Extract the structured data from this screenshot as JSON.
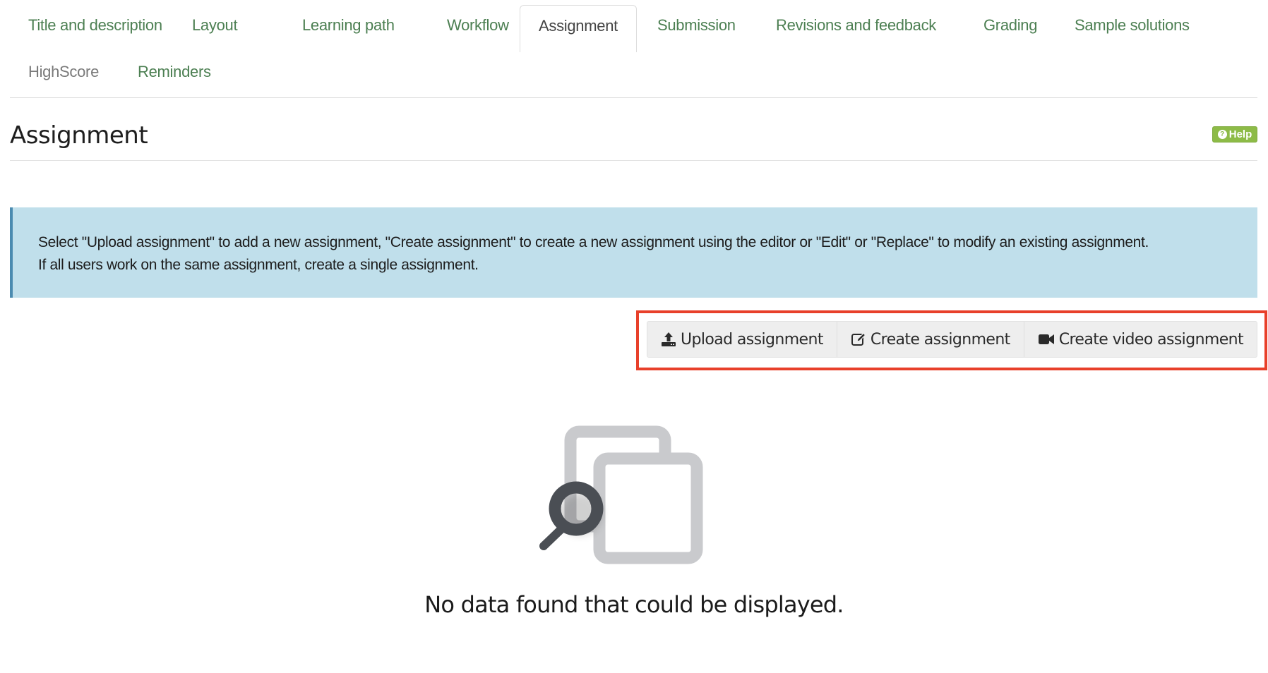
{
  "tabs": [
    {
      "label": "Title and description",
      "state": "normal"
    },
    {
      "label": "Layout",
      "state": "normal"
    },
    {
      "label": "Learning path",
      "state": "normal"
    },
    {
      "label": "Workflow",
      "state": "normal"
    },
    {
      "label": "Assignment",
      "state": "active"
    },
    {
      "label": "Submission",
      "state": "normal"
    },
    {
      "label": "Revisions and feedback",
      "state": "normal"
    },
    {
      "label": "Grading",
      "state": "normal"
    },
    {
      "label": "Sample solutions",
      "state": "normal"
    },
    {
      "label": "HighScore",
      "state": "disabled"
    },
    {
      "label": "Reminders",
      "state": "normal"
    }
  ],
  "page": {
    "title": "Assignment",
    "help_label": "Help",
    "help_icon": "question-circle-icon"
  },
  "alert": {
    "line1": "Select \"Upload assignment\" to add a new assignment, \"Create assignment\" to create a new assignment using the editor or \"Edit\" or \"Replace\" to modify an existing assignment.",
    "line2": "If all users work on the same assignment, create a single assignment."
  },
  "actions": {
    "upload": {
      "label": "Upload assignment",
      "icon": "upload-icon"
    },
    "create": {
      "label": "Create assignment",
      "icon": "edit-icon"
    },
    "video": {
      "label": "Create video assignment",
      "icon": "video-camera-icon"
    }
  },
  "empty_state": {
    "message": "No data found that could be displayed.",
    "icon": "empty-search-icon"
  },
  "colors": {
    "tab_link": "#4c7f52",
    "help_green": "#8dbb47",
    "alert_bg": "#c0dfeb",
    "alert_border": "#4b8bb0",
    "highlight": "#e8402a"
  }
}
